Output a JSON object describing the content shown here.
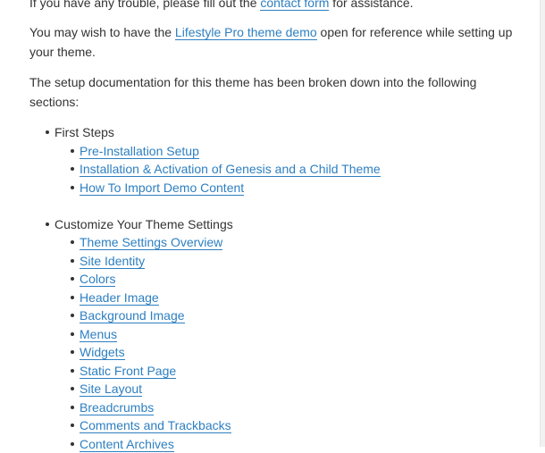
{
  "intro": {
    "p1_before": "If you have any trouble, please fill out the ",
    "p1_link": "contact form",
    "p1_after": " for assistance.",
    "p2_before": "You may wish to have the ",
    "p2_link": "Lifestyle Pro theme demo",
    "p2_after": " open for reference while setting up your theme.",
    "p3": "The setup documentation for this theme has been broken down into the following sections:"
  },
  "sections": [
    {
      "title": "First Steps",
      "links": [
        "Pre-Installation Setup",
        "Installation & Activation of Genesis and a Child Theme",
        "How To Import Demo Content"
      ]
    },
    {
      "title": "Customize Your Theme Settings",
      "links": [
        "Theme Settings Overview",
        "Site Identity",
        "Colors",
        "Header Image",
        "Background Image",
        "Menus",
        "Widgets",
        "Static Front Page",
        "Site Layout",
        "Breadcrumbs",
        "Comments and Trackbacks",
        "Content Archives"
      ]
    }
  ]
}
